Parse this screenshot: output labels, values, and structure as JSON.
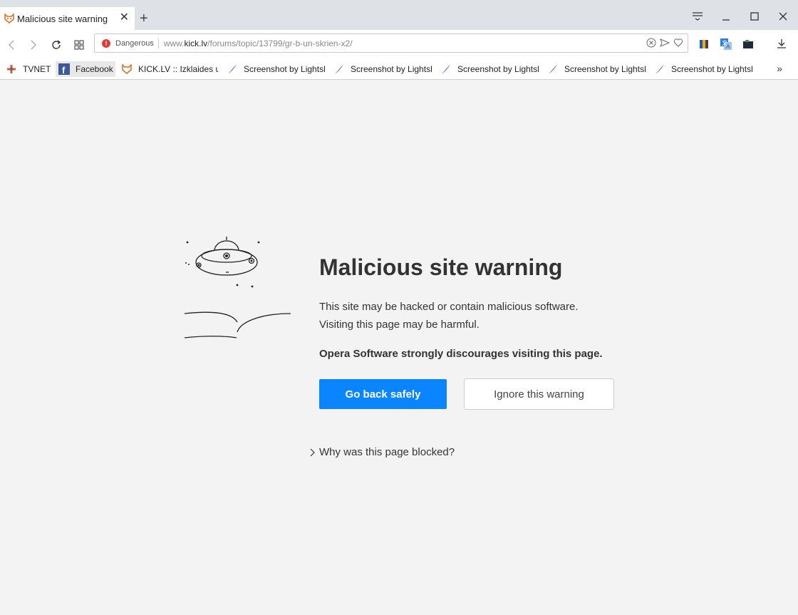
{
  "browser": {
    "tab": {
      "title": "Malicious site warning",
      "close": "✕",
      "favicon": "kick-fox-icon"
    },
    "new_tab_label": "+",
    "address": {
      "security_label": "Dangerous",
      "url_prefix": "www.",
      "url_domain": "kick.lv",
      "url_path": "/forums/topic/13799/gr-b-un-skrien-x2/"
    },
    "bookmarks": [
      {
        "label": "TVNET",
        "icon": "tvnet-icon"
      },
      {
        "label": "Facebook",
        "icon": "facebook-icon"
      },
      {
        "label": "KICK.LV :: Izklaides un",
        "icon": "kick-fox-icon"
      },
      {
        "label": "Screenshot by Lightshot",
        "icon": "lightshot-feather-icon"
      },
      {
        "label": "Screenshot by Lightshot",
        "icon": "lightshot-feather-icon"
      },
      {
        "label": "Screenshot by Lightshot",
        "icon": "lightshot-feather-icon"
      },
      {
        "label": "Screenshot by Lightshot",
        "icon": "lightshot-feather-icon"
      },
      {
        "label": "Screenshot by Lightshot",
        "icon": "lightshot-feather-icon"
      }
    ],
    "bookmarks_more": "»"
  },
  "warning": {
    "title": "Malicious site warning",
    "line1": "This site may be hacked or contain malicious software.",
    "line2": "Visiting this page may be harmful.",
    "emphasis": "Opera Software strongly discourages visiting this page.",
    "primary_button": "Go back safely",
    "secondary_button": "Ignore this warning",
    "why_link": "Why was this page blocked?"
  },
  "colors": {
    "accent": "#0a84ff",
    "danger": "#e53935",
    "page_bg": "#f3f3f3"
  }
}
